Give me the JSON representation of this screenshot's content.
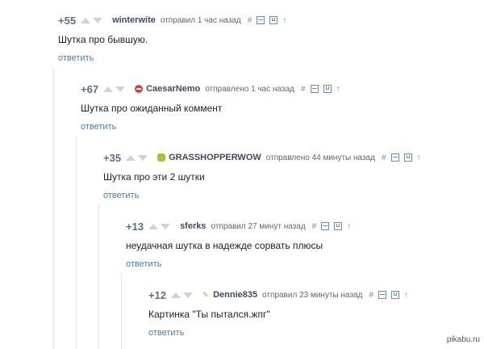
{
  "comments": [
    {
      "rating": "+55",
      "author": "winterwite",
      "meta": "отправил 1 час назад",
      "text": "Шутка про бывшую.",
      "reply": "ответить",
      "hash": "#",
      "arrow": "↑"
    },
    {
      "rating": "+67",
      "author": "CaesarNemo",
      "meta": "отправлено 1 час назад",
      "text": "Шутка про ожиданный коммент",
      "reply": "ответить",
      "hash": "#",
      "arrow": "↑"
    },
    {
      "rating": "+35",
      "author": "GRASSHOPPERWOW",
      "meta": "отправлено 44 минуты назад",
      "text": "Шутка про эти 2 шутки",
      "reply": "ответить",
      "hash": "#",
      "arrow": "↑"
    },
    {
      "rating": "+13",
      "author": "sferks",
      "meta": "отправил 27 минут назад",
      "text": "неудачная шутка в надежде сорвать плюсы",
      "reply": "ответить",
      "hash": "#",
      "arrow": "↑"
    },
    {
      "rating": "+12",
      "author": "Dennie835",
      "meta": "отправил 23 минуты назад",
      "text": "Картинка \"Ты пытался.жпг\"",
      "reply": "ответить",
      "hash": "#",
      "arrow": "↑"
    }
  ],
  "watermark": "pikabu.ru",
  "icons": {
    "upvote": "upvote-icon",
    "downvote": "downvote-icon",
    "collapse": "collapse-icon",
    "save": "save-icon"
  }
}
